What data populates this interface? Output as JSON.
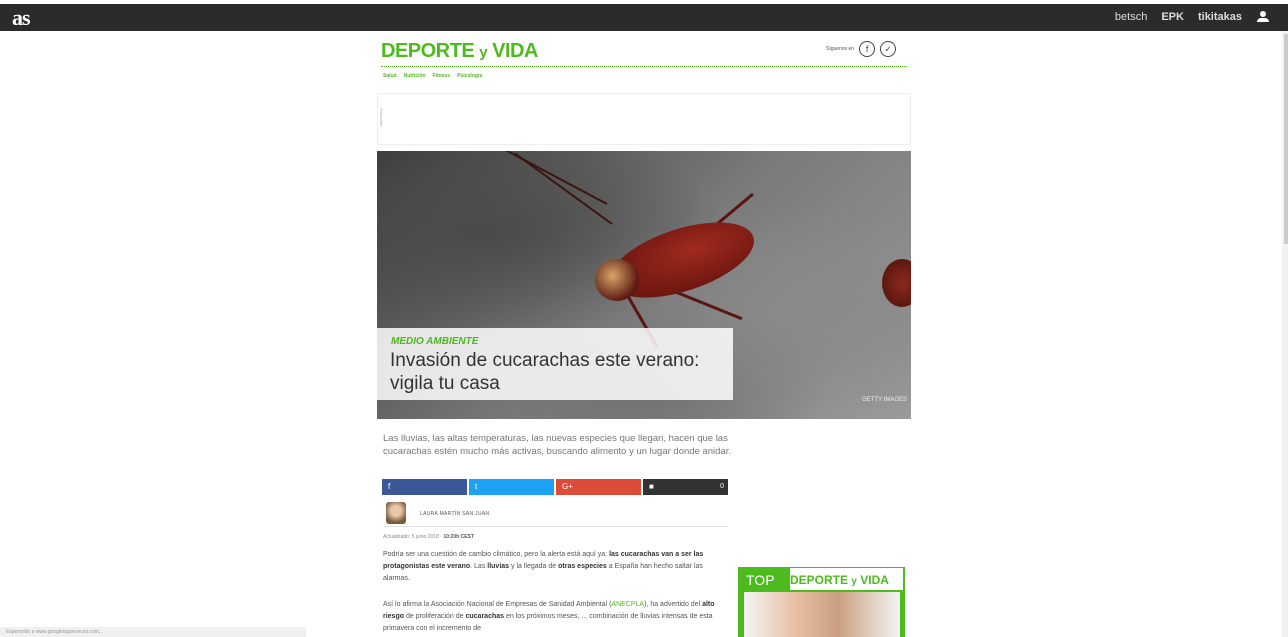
{
  "topbar": {
    "logo": "as",
    "links": [
      "betsch",
      "EPK",
      "tikitakas"
    ]
  },
  "section": {
    "title_main": "DEPORTE",
    "title_y": "y",
    "title_end": "VIDA",
    "follow_label": "Síguenos en",
    "subnav": [
      "Salud",
      "Nutrición",
      "Fitness",
      "Psicología"
    ]
  },
  "ad": {
    "label": "Publicidad"
  },
  "hero": {
    "kicker": "MEDIO AMBIENTE",
    "headline": "Invasión de cucarachas este verano: vigila tu casa",
    "credit": "GETTY IMAGES"
  },
  "lead": "Las lluvias, las altas temperaturas, las nuevas especies que llegan, hacen que las cucarachas estén mucho más activas, buscando alimento y un lugar donde anidar.",
  "share": {
    "fb": "f",
    "tw": "t",
    "gp": "G+",
    "comments": "0"
  },
  "author": {
    "name": "LAURA MARTÍN SAN JUAN"
  },
  "date": {
    "label": "Actualizado: 5 junio 2018",
    "time": "10:20h CEST"
  },
  "body": {
    "p1_a": "Podría ser una cuestión de cambio climático, pero la alerta está aquí ya: ",
    "p1_b": "las cucarachas van a ser las protagonistas este verano",
    "p1_c": ". Las ",
    "p1_d": "lluvias",
    "p1_e": " y la llegada de ",
    "p1_f": "otras especies",
    "p1_g": " a España han hecho saltar las alarmas.",
    "p2_a": "Así lo afirma la Asociación Nacional de Empresas de Sanidad Ambiental (",
    "p2_link": "ANECPLA",
    "p2_b": "), ha advertido del ",
    "p2_c": "alto riesgo",
    "p2_d": " de proliferación de ",
    "p2_e": "cucarachas",
    "p2_f": " en los próximos meses, ... combinación de lluvias intensas de esta primavera con el incremento de"
  },
  "top": {
    "label": "TOP",
    "sub_main": "DEPORTE",
    "sub_y": "y",
    "sub_end": "VIDA"
  },
  "status": "Esperando a www.googletagservices.com..."
}
